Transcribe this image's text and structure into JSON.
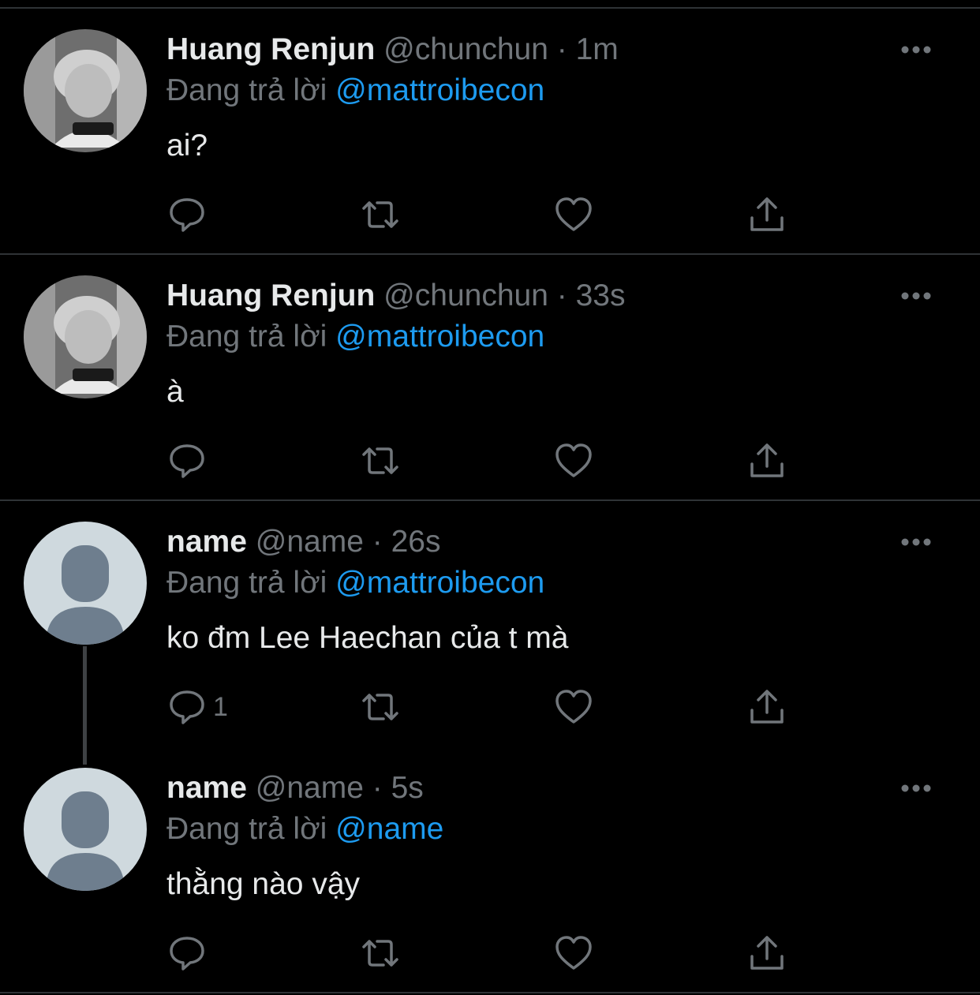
{
  "tweets": [
    {
      "name": "Huang Renjun",
      "handle": "@chunchun",
      "separator": "·",
      "time": "1m",
      "replying_prefix": "Đang trả lời",
      "replying_to": "@mattroibecon",
      "text": "ai?",
      "reply_count": "",
      "avatar": "photo"
    },
    {
      "name": "Huang Renjun",
      "handle": "@chunchun",
      "separator": "·",
      "time": "33s",
      "replying_prefix": "Đang trả lời",
      "replying_to": "@mattroibecon",
      "text": "à",
      "reply_count": "",
      "avatar": "photo"
    },
    {
      "name": "name",
      "handle": "@name",
      "separator": "·",
      "time": "26s",
      "replying_prefix": "Đang trả lời",
      "replying_to": "@mattroibecon",
      "text": "ko đm Lee Haechan của t mà",
      "reply_count": "1",
      "avatar": "default"
    },
    {
      "name": "name",
      "handle": "@name",
      "separator": "·",
      "time": "5s",
      "replying_prefix": "Đang trả lời",
      "replying_to": "@name",
      "text": "thằng nào vậy",
      "reply_count": "",
      "avatar": "default"
    }
  ],
  "icons": {
    "reply": "reply-icon",
    "retweet": "retweet-icon",
    "like": "heart-icon",
    "share": "share-icon",
    "more": "more-icon"
  },
  "colors": {
    "background": "#000000",
    "text": "#e7e9ea",
    "muted": "#71767b",
    "mention": "#1d9bf0",
    "divider": "#2f3336"
  }
}
